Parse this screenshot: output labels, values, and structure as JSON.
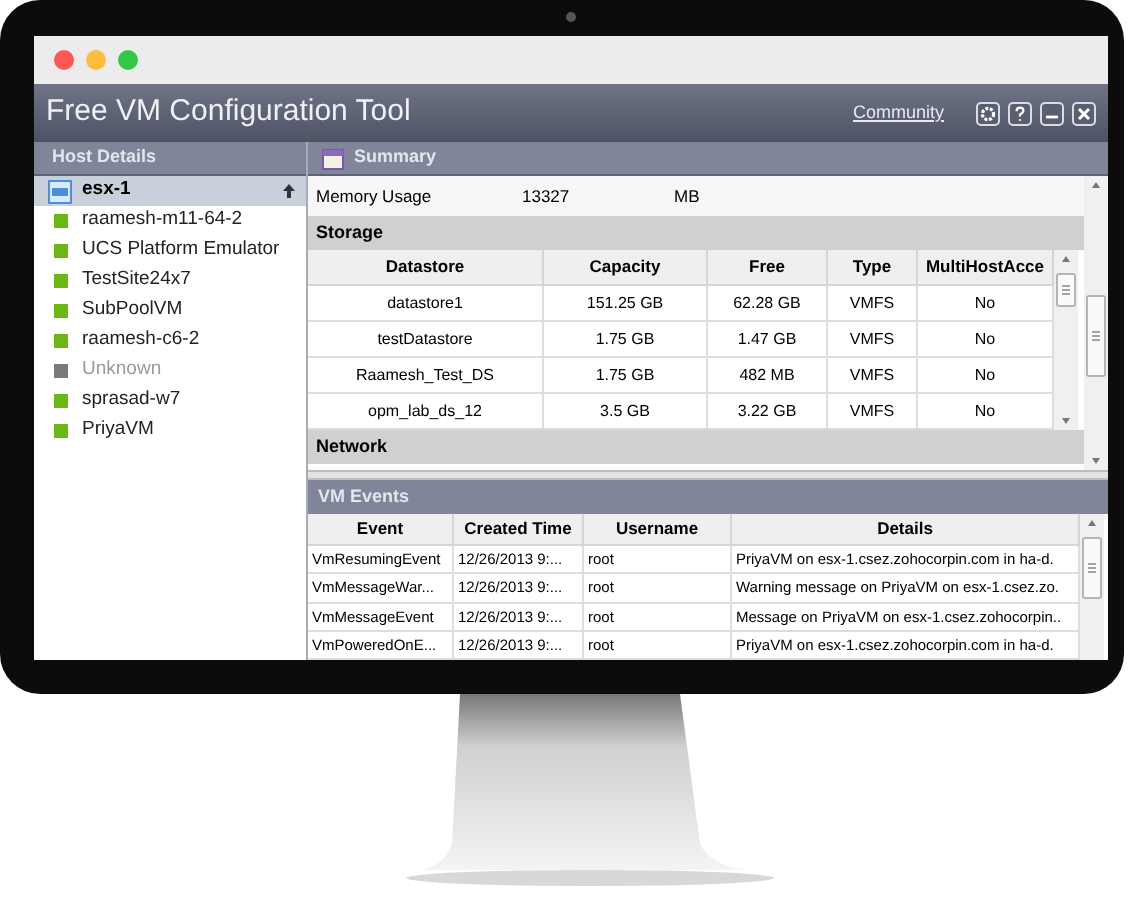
{
  "window": {
    "title": "Free VM Configuration Tool",
    "community_link": "Community"
  },
  "host_panel": {
    "title": "Host Details",
    "hosts": [
      {
        "name": "esx-1",
        "kind": "host",
        "selected": true,
        "disabled": false,
        "color": "#4a90d9"
      },
      {
        "name": "raamesh-m11-64-2",
        "kind": "vm",
        "selected": false,
        "disabled": false,
        "color": "#6cb616"
      },
      {
        "name": "UCS Platform Emulator",
        "kind": "vm",
        "selected": false,
        "disabled": false,
        "color": "#6cb616"
      },
      {
        "name": "TestSite24x7",
        "kind": "vm",
        "selected": false,
        "disabled": false,
        "color": "#6cb616"
      },
      {
        "name": "SubPoolVM",
        "kind": "vm",
        "selected": false,
        "disabled": false,
        "color": "#6cb616"
      },
      {
        "name": "raamesh-c6-2",
        "kind": "vm",
        "selected": false,
        "disabled": false,
        "color": "#6cb616"
      },
      {
        "name": "Unknown",
        "kind": "vm",
        "selected": false,
        "disabled": true,
        "color": "#7a7a7a"
      },
      {
        "name": "sprasad-w7",
        "kind": "vm",
        "selected": false,
        "disabled": false,
        "color": "#6cb616"
      },
      {
        "name": "PriyaVM",
        "kind": "vm",
        "selected": false,
        "disabled": false,
        "color": "#6cb616"
      }
    ]
  },
  "summary": {
    "title": "Summary",
    "memory": {
      "label": "Memory Usage",
      "value": "13327",
      "unit": "MB"
    },
    "storage": {
      "title": "Storage",
      "columns": [
        "Datastore",
        "Capacity",
        "Free",
        "Type",
        "MultiHostAcce"
      ],
      "rows": [
        [
          "datastore1",
          "151.25 GB",
          "62.28 GB",
          "VMFS",
          "No"
        ],
        [
          "testDatastore",
          "1.75 GB",
          "1.47 GB",
          "VMFS",
          "No"
        ],
        [
          "Raamesh_Test_DS",
          "1.75 GB",
          "482 MB",
          "VMFS",
          "No"
        ],
        [
          "opm_lab_ds_12",
          "3.5 GB",
          "3.22 GB",
          "VMFS",
          "No"
        ]
      ]
    },
    "network": {
      "title": "Network"
    }
  },
  "vm_events": {
    "title": "VM Events",
    "columns": [
      "Event",
      "Created Time",
      "Username",
      "Details"
    ],
    "rows": [
      [
        "VmResumingEvent",
        "12/26/2013 9:...",
        "root",
        "PriyaVM on  esx-1.csez.zohocorpin.com in ha-d."
      ],
      [
        "VmMessageWar...",
        "12/26/2013 9:...",
        "root",
        "Warning message on PriyaVM on esx-1.csez.zo."
      ],
      [
        "VmMessageEvent",
        "12/26/2013 9:...",
        "root",
        "Message on PriyaVM on esx-1.csez.zohocorpin.."
      ],
      [
        "VmPoweredOnE...",
        "12/26/2013 9:...",
        "root",
        "PriyaVM on  esx-1.csez.zohocorpin.com in ha-d."
      ]
    ]
  }
}
